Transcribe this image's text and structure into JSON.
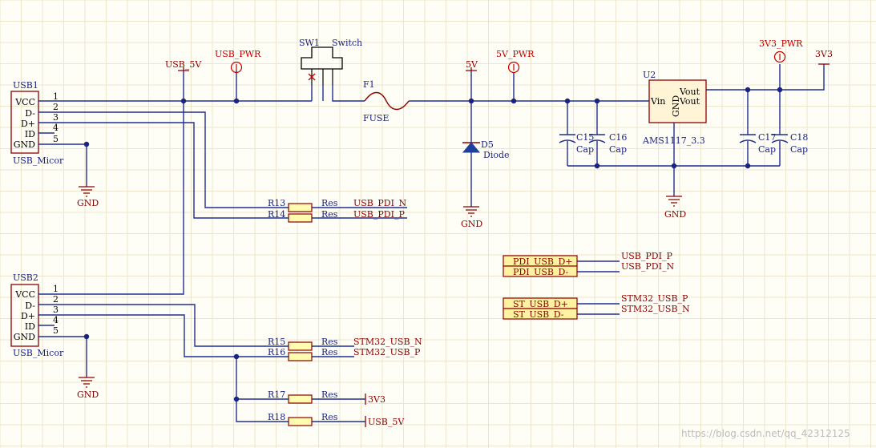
{
  "colors": {
    "background": "#fffef6",
    "grid": "#ede6cc",
    "wire": "#1f2e8f",
    "part_outline": "#8b0000",
    "connector_fill": "#fffbb0",
    "port_fill": "#fff2a0",
    "ic_fill": "#fff4d6",
    "power_port": "#c00000",
    "diode_fill": "#1f3f9f"
  },
  "usb1": {
    "designator": "USB1",
    "comment": "USB_Micor",
    "pins": [
      {
        "name": "VCC",
        "num": "1"
      },
      {
        "name": "D-",
        "num": "2"
      },
      {
        "name": "D+",
        "num": "3"
      },
      {
        "name": "ID",
        "num": "4"
      },
      {
        "name": "GND",
        "num": "5"
      }
    ]
  },
  "usb2": {
    "designator": "USB2",
    "comment": "USB_Micor",
    "pins": [
      {
        "name": "VCC",
        "num": "1"
      },
      {
        "name": "D-",
        "num": "2"
      },
      {
        "name": "D+",
        "num": "3"
      },
      {
        "name": "ID",
        "num": "4"
      },
      {
        "name": "GND",
        "num": "5"
      }
    ]
  },
  "net_labels": {
    "usb_5v": "USB_5V",
    "usb_pwr": "USB_PWR",
    "five_v": "5V",
    "five_v_pwr": "5V_PWR",
    "three_v3_pwr": "3V3_PWR",
    "three_v3": "3V3",
    "gnd": "GND"
  },
  "sw1": {
    "designator": "SW1",
    "comment": "Switch"
  },
  "f1": {
    "designator": "F1",
    "comment": "FUSE"
  },
  "d5": {
    "designator": "D5",
    "comment": "Diode"
  },
  "u2": {
    "designator": "U2",
    "comment": "AMS1117_3.3",
    "pin_vin": "Vin",
    "pin_gnd": "GND",
    "pin_vout1": "Vout",
    "pin_vout2": "Vout"
  },
  "caps": [
    {
      "designator": "C15",
      "comment": "Cap"
    },
    {
      "designator": "C16",
      "comment": "Cap"
    },
    {
      "designator": "C17",
      "comment": "Cap"
    },
    {
      "designator": "C18",
      "comment": "Cap"
    }
  ],
  "resistors": [
    {
      "designator": "R13",
      "comment": "Res",
      "net": "USB_PDI_N"
    },
    {
      "designator": "R14",
      "comment": "Res",
      "net": "USB_PDI_P"
    },
    {
      "designator": "R15",
      "comment": "Res",
      "net": "STM32_USB_N"
    },
    {
      "designator": "R16",
      "comment": "Res",
      "net": "STM32_USB_P"
    },
    {
      "designator": "R17",
      "comment": "Res",
      "net": "3V3"
    },
    {
      "designator": "R18",
      "comment": "Res",
      "net": "USB_5V"
    }
  ],
  "ports": [
    {
      "label": "PDI_USB_D+",
      "net": "USB_PDI_P"
    },
    {
      "label": "PDI_USB_D-",
      "net": "USB_PDI_N"
    },
    {
      "label": "ST_USB_D+",
      "net": "STM32_USB_P"
    },
    {
      "label": "ST_USB_D-",
      "net": "STM32_USB_N"
    }
  ],
  "watermark": "https://blog.csdn.net/qq_42312125"
}
